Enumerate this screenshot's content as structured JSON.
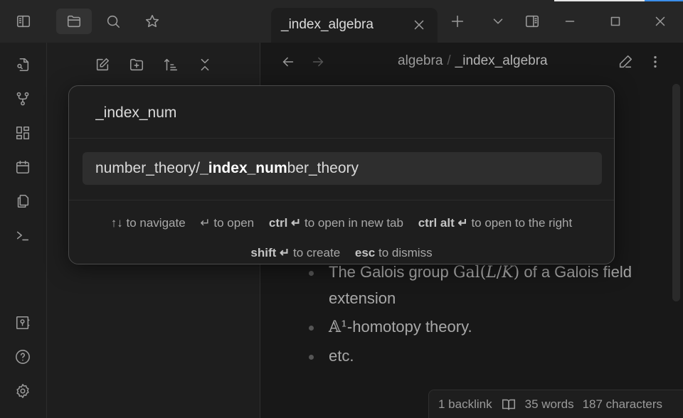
{
  "titlebar": {
    "left_buttons": [
      {
        "name": "toggle-left-sidebar",
        "icon": "sidebar-left-icon"
      },
      {
        "name": "files",
        "icon": "folder-icon",
        "active": true
      },
      {
        "name": "search",
        "icon": "search-icon"
      },
      {
        "name": "bookmarks",
        "icon": "star-icon"
      }
    ],
    "tab": {
      "title": "_index_algebra"
    },
    "right_buttons": [
      "new-tab",
      "tab-list",
      "toggle-right-sidebar",
      "minimize",
      "maximize",
      "close"
    ]
  },
  "ribbon": {
    "top": [
      "search-file",
      "graph-view",
      "canvas",
      "daily-note",
      "templates",
      "command-palette"
    ],
    "bottom": [
      "vault",
      "help",
      "settings"
    ]
  },
  "sidebar_toolbar": [
    "new-note",
    "new-folder",
    "sort",
    "collapse-all"
  ],
  "editor": {
    "breadcrumb": {
      "folder": "algebra",
      "separator": "/",
      "file": "_index_algebra"
    },
    "bullets": [
      {
        "prefix": "The Galois group ",
        "math": "Gal(L/K)",
        "suffix": " of a Galois field extension"
      },
      {
        "math": "𝔸¹",
        "suffix": "-homotopy theory."
      },
      {
        "text": "etc."
      }
    ]
  },
  "statusbar": {
    "backlinks": "1 backlink",
    "words": "35 words",
    "characters": "187 characters"
  },
  "switcher": {
    "query": "_index_num",
    "result": {
      "pre": "number_theory/",
      "match": "_index_num",
      "post": "ber_theory"
    },
    "instructions": [
      {
        "key": "↑↓",
        "text": "to navigate"
      },
      {
        "key": "↵",
        "text": "to open"
      },
      {
        "key": "ctrl ↵",
        "text": "to open in new tab"
      },
      {
        "key": "ctrl alt ↵",
        "text": "to open to the right"
      },
      {
        "key": "shift ↵",
        "text": "to create"
      },
      {
        "key": "esc",
        "text": "to dismiss"
      }
    ]
  },
  "colors": {
    "accent": "#3b8eea",
    "background": "#1e1e1e",
    "editor_bg": "#181818"
  }
}
